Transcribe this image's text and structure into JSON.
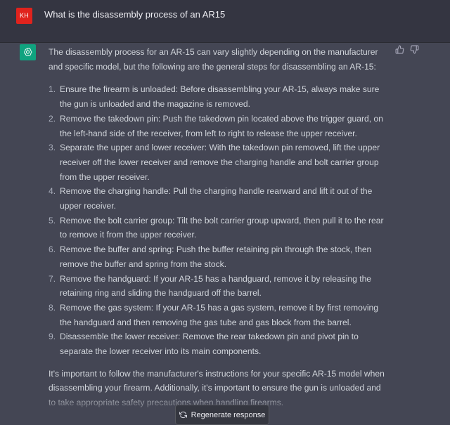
{
  "user": {
    "initials": "KH",
    "message": "What is the disassembly process of an AR15"
  },
  "assistant": {
    "avatar_icon": "openai-logo-icon",
    "intro": "The disassembly process for an AR-15 can vary slightly depending on the manufacturer and specific model, but the following are the general steps for disassembling an AR-15:",
    "steps": [
      {
        "num": "1.",
        "text": "Ensure the firearm is unloaded: Before disassembling your AR-15, always make sure the gun is unloaded and the magazine is removed."
      },
      {
        "num": "2.",
        "text": "Remove the takedown pin: Push the takedown pin located above the trigger guard, on the left-hand side of the receiver, from left to right to release the upper receiver."
      },
      {
        "num": "3.",
        "text": "Separate the upper and lower receiver: With the takedown pin removed, lift the upper receiver off the lower receiver and remove the charging handle and bolt carrier group from the upper receiver."
      },
      {
        "num": "4.",
        "text": "Remove the charging handle: Pull the charging handle rearward and lift it out of the upper receiver."
      },
      {
        "num": "5.",
        "text": "Remove the bolt carrier group: Tilt the bolt carrier group upward, then pull it to the rear to remove it from the upper receiver."
      },
      {
        "num": "6.",
        "text": "Remove the buffer and spring: Push the buffer retaining pin through the stock, then remove the buffer and spring from the stock."
      },
      {
        "num": "7.",
        "text": "Remove the handguard: If your AR-15 has a handguard, remove it by releasing the retaining ring and sliding the handguard off the barrel."
      },
      {
        "num": "8.",
        "text": "Remove the gas system: If your AR-15 has a gas system, remove it by first removing the handguard and then removing the gas tube and gas block from the barrel."
      },
      {
        "num": "9.",
        "text": "Disassemble the lower receiver: Remove the rear takedown pin and pivot pin to separate the lower receiver into its main components."
      }
    ],
    "outro": "It's important to follow the manufacturer's instructions for your specific AR-15 model when disassembling your firearm. Additionally, it's important to ensure the gun is unloaded and to take appropriate safety precautions when handling firearms."
  },
  "actions": {
    "regenerate_label": "Regenerate response",
    "thumbs_up_icon": "thumbs-up-icon",
    "thumbs_down_icon": "thumbs-down-icon"
  },
  "colors": {
    "user_bg": "#343541",
    "assistant_bg": "#444654",
    "avatar_user": "#e0231d",
    "avatar_bot": "#10a37f"
  }
}
